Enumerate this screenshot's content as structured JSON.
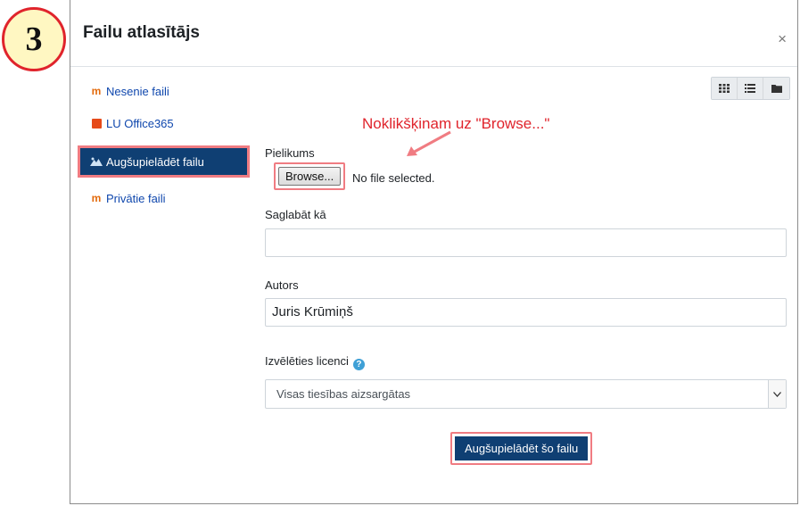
{
  "step_number": "3",
  "dialog": {
    "title": "Failu atlasītājs",
    "close": "×"
  },
  "sidebar": {
    "items": [
      {
        "label": "Nesenie faili",
        "icon": "moodle-icon"
      },
      {
        "label": "LU Office365",
        "icon": "office365-icon"
      },
      {
        "label": "Augšupielādēt failu",
        "icon": "upload-icon",
        "active": true
      },
      {
        "label": "Privātie faili",
        "icon": "moodle-icon"
      }
    ]
  },
  "view_buttons": [
    "grid-icon",
    "list-icon",
    "folder-icon"
  ],
  "annotation": "Noklikšķinam uz \"Browse...\"",
  "form": {
    "attachment_label": "Pielikums",
    "browse_label": "Browse...",
    "no_file_text": "No file selected.",
    "save_as_label": "Saglabāt kā",
    "save_as_value": "",
    "author_label": "Autors",
    "author_value": "Juris Krūmiņš",
    "license_label": "Izvēlēties licenci",
    "license_value": "Visas tiesības aizsargātas",
    "upload_button": "Augšupielādēt šo failu"
  },
  "colors": {
    "primary": "#0f3f73",
    "highlight": "#f07c82",
    "annotation": "#e0242c",
    "link": "#0f47ad"
  }
}
